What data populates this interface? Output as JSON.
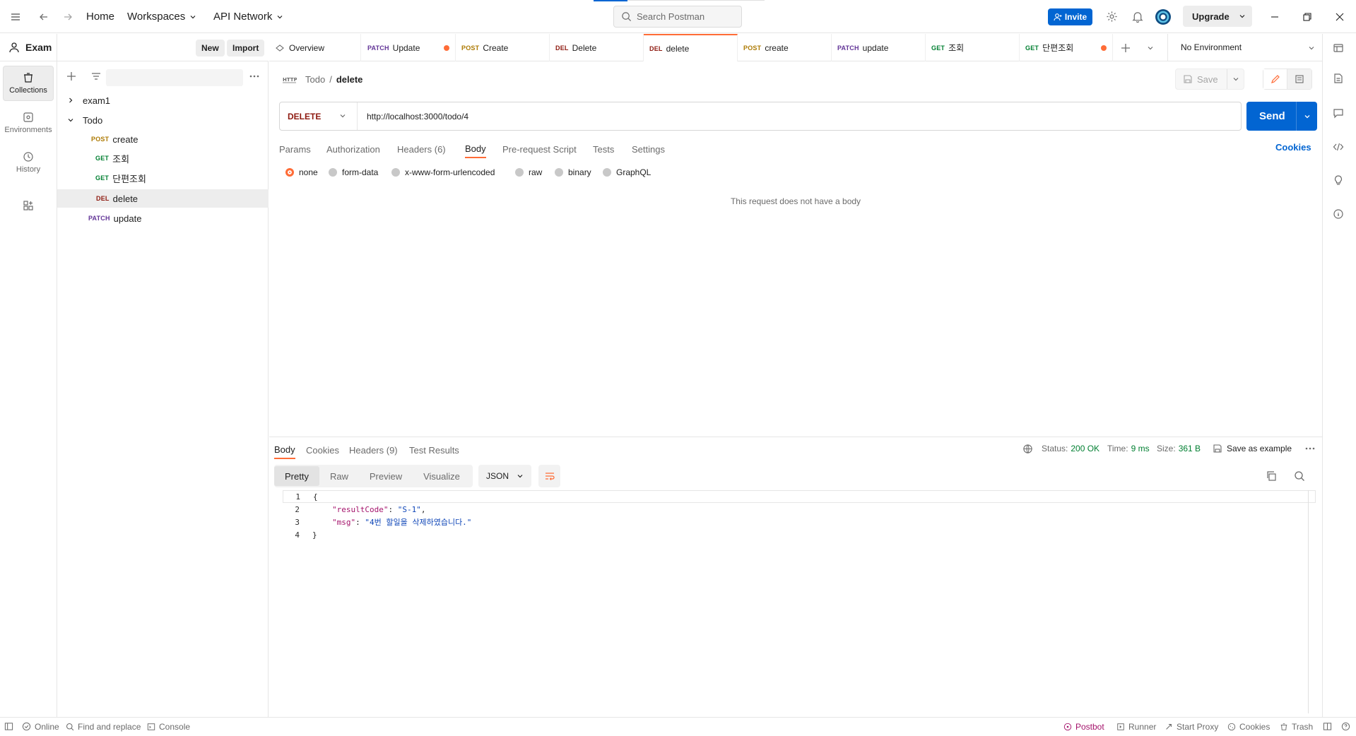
{
  "topbar": {
    "nav": {
      "home": "Home",
      "workspaces": "Workspaces",
      "api_network": "API Network"
    },
    "search_placeholder": "Search Postman",
    "invite_label": "Invite",
    "upgrade_label": "Upgrade"
  },
  "workspace": {
    "name": "Exam",
    "new_label": "New",
    "import_label": "Import"
  },
  "rail": {
    "collections": "Collections",
    "environments": "Environments",
    "history": "History"
  },
  "sidebar": {
    "tree": [
      {
        "type": "folder",
        "label": "exam1",
        "expanded": false
      },
      {
        "type": "folder",
        "label": "Todo",
        "expanded": true
      },
      {
        "method": "POST",
        "label": "create"
      },
      {
        "method": "GET",
        "label": "조회"
      },
      {
        "method": "GET",
        "label": "단편조회"
      },
      {
        "method": "DEL",
        "label": "delete",
        "selected": true
      },
      {
        "method": "PATCH",
        "label": "update"
      }
    ]
  },
  "tabs": [
    {
      "label": "Overview"
    },
    {
      "method": "PATCH",
      "label": "Update",
      "unsaved": true
    },
    {
      "method": "POST",
      "label": "Create"
    },
    {
      "method": "DEL",
      "label": "Delete"
    },
    {
      "method": "DEL",
      "label": "delete",
      "active": true
    },
    {
      "method": "POST",
      "label": "create"
    },
    {
      "method": "PATCH",
      "label": "update"
    },
    {
      "method": "GET",
      "label": "조회"
    },
    {
      "method": "GET",
      "label": "단편조회",
      "unsaved": true
    }
  ],
  "environment": {
    "selected": "No Environment"
  },
  "request": {
    "breadcrumb": {
      "collection": "Todo",
      "separator": "/",
      "name": "delete"
    },
    "save_label": "Save",
    "method": "DELETE",
    "url": "http://localhost:3000/todo/4",
    "send_label": "Send",
    "tabs": [
      "Params",
      "Authorization",
      "Headers (6)",
      "Body",
      "Pre-request Script",
      "Tests",
      "Settings"
    ],
    "active_tab": "Body",
    "cookies_label": "Cookies",
    "body_types": [
      "none",
      "form-data",
      "x-www-form-urlencoded",
      "raw",
      "binary",
      "GraphQL"
    ],
    "body_selected": "none",
    "no_body_text": "This request does not have a body"
  },
  "response": {
    "tabs": [
      "Body",
      "Cookies",
      "Headers (9)",
      "Test Results"
    ],
    "active_tab": "Body",
    "status_label": "Status:",
    "status_value": "200 OK",
    "time_label": "Time:",
    "time_value": "9 ms",
    "size_label": "Size:",
    "size_value": "361 B",
    "save_example_label": "Save as example",
    "views": [
      "Pretty",
      "Raw",
      "Preview",
      "Visualize"
    ],
    "active_view": "Pretty",
    "format": "JSON",
    "body_lines": [
      {
        "n": "1",
        "text": "{"
      },
      {
        "n": "2",
        "key": "\"resultCode\"",
        "colon": ": ",
        "value": "\"S-1\"",
        "trail": ","
      },
      {
        "n": "3",
        "key": "\"msg\"",
        "colon": ": ",
        "value": "\"4번 할일을 삭제하였습니다.\"",
        "trail": ""
      },
      {
        "n": "4",
        "text": "}"
      }
    ]
  },
  "statusbar": {
    "online": "Online",
    "find_replace": "Find and replace",
    "console": "Console",
    "postbot": "Postbot",
    "runner": "Runner",
    "start_proxy": "Start Proxy",
    "cookies": "Cookies",
    "trash": "Trash"
  },
  "colors": {
    "accent": "#ff6c37",
    "primary": "#0265d2",
    "get": "#007f31",
    "post": "#ad7a03",
    "delete": "#8e1a10",
    "patch": "#623497"
  }
}
